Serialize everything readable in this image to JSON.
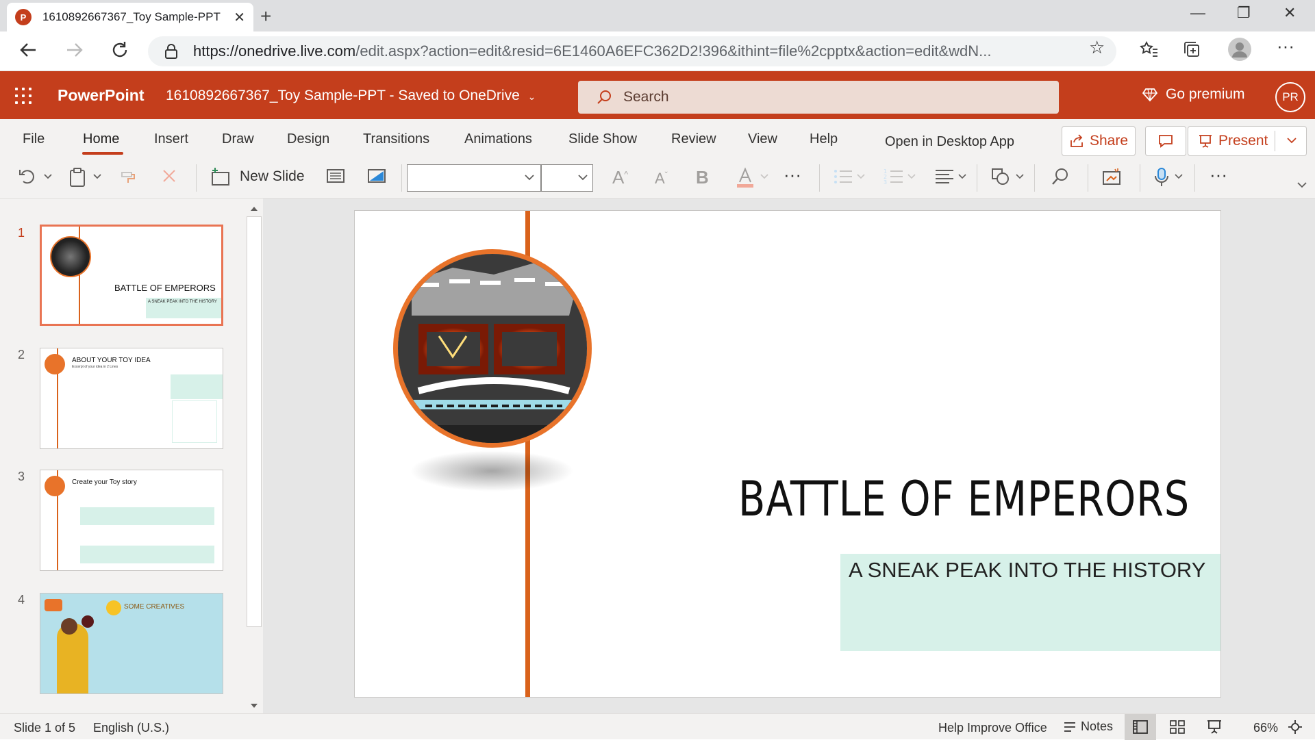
{
  "browser": {
    "tab_title": "1610892667367_Toy Sample-PPT",
    "tab_favicon": "P",
    "url_host": "https://onedrive.live.com",
    "url_rest": "/edit.aspx?action=edit&resid=6E1460A6EFC362D2!396&ithint=file%2cpptx&action=edit&wdN..."
  },
  "app": {
    "name": "PowerPoint",
    "doc_title": "1610892667367_Toy Sample-PPT  -  Saved to OneDrive",
    "search_placeholder": "Search",
    "premium_label": "Go premium",
    "avatar_initials": "PR"
  },
  "ribbon": {
    "tabs": [
      "File",
      "Home",
      "Insert",
      "Draw",
      "Design",
      "Transitions",
      "Animations",
      "Slide Show",
      "Review",
      "View",
      "Help"
    ],
    "active_tab": "Home",
    "open_desktop": "Open in Desktop App",
    "share_label": "Share",
    "present_label": "Present",
    "new_slide_label": "New Slide",
    "bold_label": "B"
  },
  "thumbnails": [
    {
      "num": "1",
      "title": "BATTLE OF EMPERORS",
      "subtitle": "A SNEAK PEAK INTO THE HISTORY"
    },
    {
      "num": "2",
      "title": "ABOUT YOUR  TOY IDEA",
      "subtitle": "Excerpt of your idea in 2 Lines"
    },
    {
      "num": "3",
      "title": "Create your Toy story"
    },
    {
      "num": "4",
      "title": "SOME CREATIVES"
    }
  ],
  "slide": {
    "title": "BATTLE OF EMPERORS",
    "subtitle": "A SNEAK PEAK INTO THE HISTORY"
  },
  "status": {
    "slide_info": "Slide 1 of 5",
    "language": "English (U.S.)",
    "help_improve": "Help Improve Office",
    "notes_label": "Notes",
    "zoom": "66%"
  },
  "colors": {
    "brand": "#c43e1c",
    "accent_orange": "#d9621b",
    "subtitle_bg": "#d7f1e9"
  }
}
